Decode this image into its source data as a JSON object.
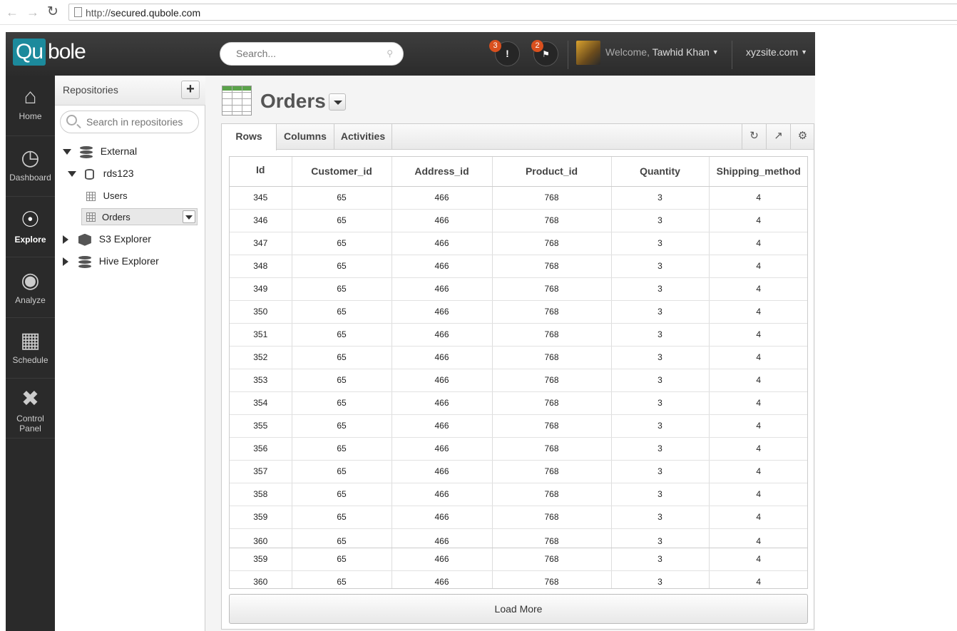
{
  "browser": {
    "url_prefix": "http://",
    "url_host": "secured.qubole.com"
  },
  "header": {
    "logo_left": "Qu",
    "logo_right": "bole",
    "search_placeholder": "Search...",
    "alerts_count": "3",
    "notifications_count": "2",
    "welcome_label": "Welcome,",
    "user_name": "Tawhid Khan",
    "site_name": "xyzsite.com"
  },
  "nav": {
    "items": [
      {
        "label": "Home",
        "icon": "home-icon"
      },
      {
        "label": "Dashboard",
        "icon": "gauge-icon"
      },
      {
        "label": "Explore",
        "icon": "compass-icon"
      },
      {
        "label": "Analyze",
        "icon": "eye-icon"
      },
      {
        "label": "Schedule",
        "icon": "calendar-clock-icon"
      },
      {
        "label": "Control Panel",
        "icon": "tools-icon"
      }
    ],
    "active": "Explore"
  },
  "repositories": {
    "title": "Repositories",
    "add_label": "+",
    "search_placeholder": "Search in repositories",
    "tree": {
      "external": "External",
      "rds": "rds123",
      "users": "Users",
      "orders": "Orders",
      "s3": "S3 Explorer",
      "hive": "Hive Explorer"
    }
  },
  "main": {
    "title": "Orders",
    "tabs": [
      "Rows",
      "Columns",
      "Activities"
    ],
    "active_tab": "Rows",
    "table": {
      "columns": [
        "Id",
        "Customer_id",
        "Address_id",
        "Product_id",
        "Quantity",
        "Shipping_method"
      ],
      "rows": [
        [
          "345",
          "65",
          "466",
          "768",
          "3",
          "4"
        ],
        [
          "346",
          "65",
          "466",
          "768",
          "3",
          "4"
        ],
        [
          "347",
          "65",
          "466",
          "768",
          "3",
          "4"
        ],
        [
          "348",
          "65",
          "466",
          "768",
          "3",
          "4"
        ],
        [
          "349",
          "65",
          "466",
          "768",
          "3",
          "4"
        ],
        [
          "350",
          "65",
          "466",
          "768",
          "3",
          "4"
        ],
        [
          "351",
          "65",
          "466",
          "768",
          "3",
          "4"
        ],
        [
          "352",
          "65",
          "466",
          "768",
          "3",
          "4"
        ],
        [
          "353",
          "65",
          "466",
          "768",
          "3",
          "4"
        ],
        [
          "354",
          "65",
          "466",
          "768",
          "3",
          "4"
        ],
        [
          "355",
          "65",
          "466",
          "768",
          "3",
          "4"
        ],
        [
          "356",
          "65",
          "466",
          "768",
          "3",
          "4"
        ],
        [
          "357",
          "65",
          "466",
          "768",
          "3",
          "4"
        ],
        [
          "358",
          "65",
          "466",
          "768",
          "3",
          "4"
        ],
        [
          "359",
          "65",
          "466",
          "768",
          "3",
          "4"
        ],
        [
          "360",
          "65",
          "466",
          "768",
          "3",
          "4"
        ],
        [
          "359",
          "65",
          "466",
          "768",
          "3",
          "4"
        ],
        [
          "360",
          "65",
          "466",
          "768",
          "3",
          "4"
        ]
      ]
    },
    "load_more_label": "Load More"
  }
}
